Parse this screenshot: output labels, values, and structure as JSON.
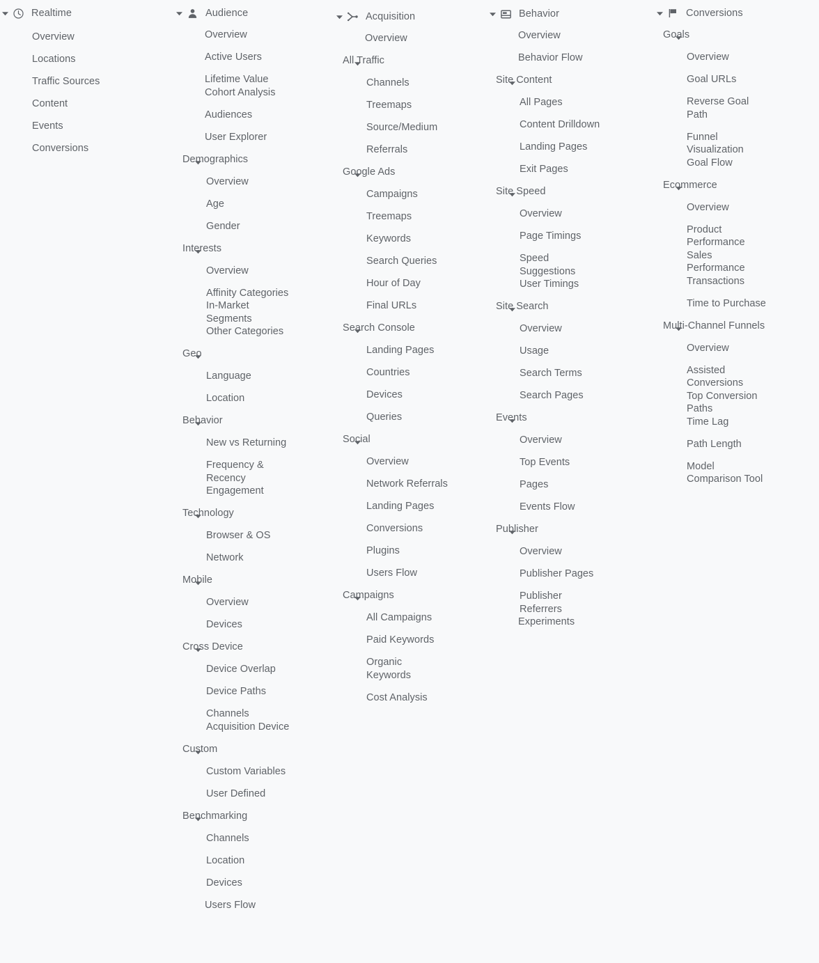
{
  "page": {
    "title": "Analytics Report Navigation Sitemap",
    "background_color": "#f8f9fa",
    "text_color": "#5f6368"
  },
  "columns": [
    {
      "id": "realtime",
      "icon": "clock-icon",
      "header": "Realtime",
      "items": [
        {
          "label": "Overview",
          "depth": 1,
          "group": false,
          "gap": "normal"
        },
        {
          "label": "Locations",
          "depth": 1,
          "group": false,
          "gap": "normal"
        },
        {
          "label": "Traffic Sources",
          "depth": 1,
          "group": false,
          "gap": "normal"
        },
        {
          "label": "Content",
          "depth": 1,
          "group": false,
          "gap": "normal"
        },
        {
          "label": "Events",
          "depth": 1,
          "group": false,
          "gap": "normal"
        },
        {
          "label": "Conversions",
          "depth": 1,
          "group": false,
          "gap": "normal"
        }
      ]
    },
    {
      "id": "audience",
      "icon": "person-icon",
      "header": "Audience",
      "items": [
        {
          "label": "Overview",
          "depth": 0,
          "group": false,
          "gap": "first"
        },
        {
          "label": "Active Users",
          "depth": 0,
          "group": false,
          "gap": "normal"
        },
        {
          "label": "Lifetime Value",
          "depth": 0,
          "group": false,
          "gap": "normal"
        },
        {
          "label": "Cohort Analysis",
          "depth": 0,
          "group": false,
          "gap": "tight"
        },
        {
          "label": "Audiences",
          "depth": 0,
          "group": false,
          "gap": "normal"
        },
        {
          "label": "User Explorer",
          "depth": 0,
          "group": false,
          "gap": "normal"
        },
        {
          "label": "Demographics",
          "depth": 0,
          "group": true,
          "gap": "normal"
        },
        {
          "label": "Overview",
          "depth": 1,
          "group": false,
          "gap": "normal"
        },
        {
          "label": "Age",
          "depth": 1,
          "group": false,
          "gap": "normal"
        },
        {
          "label": "Gender",
          "depth": 1,
          "group": false,
          "gap": "normal"
        },
        {
          "label": "Interests",
          "depth": 0,
          "group": true,
          "gap": "normal"
        },
        {
          "label": "Overview",
          "depth": 1,
          "group": false,
          "gap": "normal"
        },
        {
          "label": "Affinity Categories",
          "depth": 1,
          "group": false,
          "gap": "normal"
        },
        {
          "label": "In-Market Segments",
          "depth": 1,
          "group": false,
          "gap": "tight"
        },
        {
          "label": "Other Categories",
          "depth": 1,
          "group": false,
          "gap": "tight"
        },
        {
          "label": "Geo",
          "depth": 0,
          "group": true,
          "gap": "normal"
        },
        {
          "label": "Language",
          "depth": 1,
          "group": false,
          "gap": "normal"
        },
        {
          "label": "Location",
          "depth": 1,
          "group": false,
          "gap": "normal"
        },
        {
          "label": "Behavior",
          "depth": 0,
          "group": true,
          "gap": "normal"
        },
        {
          "label": "New vs Returning",
          "depth": 1,
          "group": false,
          "gap": "normal"
        },
        {
          "label": "Frequency & Recency",
          "depth": 1,
          "group": false,
          "gap": "normal"
        },
        {
          "label": "Engagement",
          "depth": 1,
          "group": false,
          "gap": "tight"
        },
        {
          "label": "Technology",
          "depth": 0,
          "group": true,
          "gap": "normal"
        },
        {
          "label": "Browser & OS",
          "depth": 1,
          "group": false,
          "gap": "normal"
        },
        {
          "label": "Network",
          "depth": 1,
          "group": false,
          "gap": "normal"
        },
        {
          "label": "Mobile",
          "depth": 0,
          "group": true,
          "gap": "normal"
        },
        {
          "label": "Overview",
          "depth": 1,
          "group": false,
          "gap": "normal"
        },
        {
          "label": "Devices",
          "depth": 1,
          "group": false,
          "gap": "normal"
        },
        {
          "label": "Cross Device",
          "depth": 0,
          "group": true,
          "gap": "normal"
        },
        {
          "label": "Device Overlap",
          "depth": 1,
          "group": false,
          "gap": "normal"
        },
        {
          "label": "Device Paths",
          "depth": 1,
          "group": false,
          "gap": "normal"
        },
        {
          "label": "Channels",
          "depth": 1,
          "group": false,
          "gap": "normal"
        },
        {
          "label": "Acquisition Device",
          "depth": 1,
          "group": false,
          "gap": "tight"
        },
        {
          "label": "Custom",
          "depth": 0,
          "group": true,
          "gap": "normal"
        },
        {
          "label": "Custom Variables",
          "depth": 1,
          "group": false,
          "gap": "normal"
        },
        {
          "label": "User Defined",
          "depth": 1,
          "group": false,
          "gap": "normal"
        },
        {
          "label": "Benchmarking",
          "depth": 0,
          "group": true,
          "gap": "normal"
        },
        {
          "label": "Channels",
          "depth": 1,
          "group": false,
          "gap": "normal"
        },
        {
          "label": "Location",
          "depth": 1,
          "group": false,
          "gap": "normal"
        },
        {
          "label": "Devices",
          "depth": 1,
          "group": false,
          "gap": "normal"
        },
        {
          "label": "Users Flow",
          "depth": 0,
          "group": false,
          "gap": "normal"
        }
      ]
    },
    {
      "id": "acquisition",
      "icon": "branch-icon",
      "header": "Acquisition",
      "items": [
        {
          "label": "Overview",
          "depth": 0,
          "group": false,
          "gap": "first"
        },
        {
          "label": "All Traffic",
          "depth": 0,
          "group": true,
          "gap": "normal"
        },
        {
          "label": "Channels",
          "depth": 1,
          "group": false,
          "gap": "normal"
        },
        {
          "label": "Treemaps",
          "depth": 1,
          "group": false,
          "gap": "normal"
        },
        {
          "label": "Source/Medium",
          "depth": 1,
          "group": false,
          "gap": "normal"
        },
        {
          "label": "Referrals",
          "depth": 1,
          "group": false,
          "gap": "normal"
        },
        {
          "label": "Google Ads",
          "depth": 0,
          "group": true,
          "gap": "normal"
        },
        {
          "label": "Campaigns",
          "depth": 1,
          "group": false,
          "gap": "normal"
        },
        {
          "label": "Treemaps",
          "depth": 1,
          "group": false,
          "gap": "normal"
        },
        {
          "label": "Keywords",
          "depth": 1,
          "group": false,
          "gap": "normal"
        },
        {
          "label": "Search Queries",
          "depth": 1,
          "group": false,
          "gap": "normal"
        },
        {
          "label": "Hour of Day",
          "depth": 1,
          "group": false,
          "gap": "normal"
        },
        {
          "label": "Final URLs",
          "depth": 1,
          "group": false,
          "gap": "normal"
        },
        {
          "label": "Search Console",
          "depth": 0,
          "group": true,
          "gap": "normal"
        },
        {
          "label": "Landing Pages",
          "depth": 1,
          "group": false,
          "gap": "normal"
        },
        {
          "label": "Countries",
          "depth": 1,
          "group": false,
          "gap": "normal"
        },
        {
          "label": "Devices",
          "depth": 1,
          "group": false,
          "gap": "normal"
        },
        {
          "label": "Queries",
          "depth": 1,
          "group": false,
          "gap": "normal"
        },
        {
          "label": "Social",
          "depth": 0,
          "group": true,
          "gap": "normal"
        },
        {
          "label": "Overview",
          "depth": 1,
          "group": false,
          "gap": "normal"
        },
        {
          "label": "Network Referrals",
          "depth": 1,
          "group": false,
          "gap": "normal"
        },
        {
          "label": "Landing Pages",
          "depth": 1,
          "group": false,
          "gap": "normal"
        },
        {
          "label": "Conversions",
          "depth": 1,
          "group": false,
          "gap": "normal"
        },
        {
          "label": "Plugins",
          "depth": 1,
          "group": false,
          "gap": "normal"
        },
        {
          "label": "Users Flow",
          "depth": 1,
          "group": false,
          "gap": "normal"
        },
        {
          "label": "Campaigns",
          "depth": 0,
          "group": true,
          "gap": "normal"
        },
        {
          "label": "All Campaigns",
          "depth": 1,
          "group": false,
          "gap": "normal"
        },
        {
          "label": "Paid Keywords",
          "depth": 1,
          "group": false,
          "gap": "normal"
        },
        {
          "label": "Organic Keywords",
          "depth": 1,
          "group": false,
          "gap": "normal"
        },
        {
          "label": "Cost Analysis",
          "depth": 1,
          "group": false,
          "gap": "normal"
        }
      ]
    },
    {
      "id": "behavior",
      "icon": "layout-icon",
      "header": "Behavior",
      "items": [
        {
          "label": "Overview",
          "depth": 0,
          "group": false,
          "gap": "first"
        },
        {
          "label": "Behavior Flow",
          "depth": 0,
          "group": false,
          "gap": "normal"
        },
        {
          "label": "Site Content",
          "depth": 0,
          "group": true,
          "gap": "normal"
        },
        {
          "label": "All Pages",
          "depth": 1,
          "group": false,
          "gap": "normal"
        },
        {
          "label": "Content Drilldown",
          "depth": 1,
          "group": false,
          "gap": "normal"
        },
        {
          "label": "Landing Pages",
          "depth": 1,
          "group": false,
          "gap": "normal"
        },
        {
          "label": "Exit Pages",
          "depth": 1,
          "group": false,
          "gap": "normal"
        },
        {
          "label": "Site Speed",
          "depth": 0,
          "group": true,
          "gap": "normal"
        },
        {
          "label": "Overview",
          "depth": 1,
          "group": false,
          "gap": "normal"
        },
        {
          "label": "Page Timings",
          "depth": 1,
          "group": false,
          "gap": "normal"
        },
        {
          "label": "Speed Suggestions",
          "depth": 1,
          "group": false,
          "gap": "normal"
        },
        {
          "label": "User Timings",
          "depth": 1,
          "group": false,
          "gap": "tight"
        },
        {
          "label": "Site Search",
          "depth": 0,
          "group": true,
          "gap": "normal"
        },
        {
          "label": "Overview",
          "depth": 1,
          "group": false,
          "gap": "normal"
        },
        {
          "label": "Usage",
          "depth": 1,
          "group": false,
          "gap": "normal"
        },
        {
          "label": "Search Terms",
          "depth": 1,
          "group": false,
          "gap": "normal"
        },
        {
          "label": "Search Pages",
          "depth": 1,
          "group": false,
          "gap": "normal"
        },
        {
          "label": "Events",
          "depth": 0,
          "group": true,
          "gap": "normal"
        },
        {
          "label": "Overview",
          "depth": 1,
          "group": false,
          "gap": "normal"
        },
        {
          "label": "Top Events",
          "depth": 1,
          "group": false,
          "gap": "normal"
        },
        {
          "label": "Pages",
          "depth": 1,
          "group": false,
          "gap": "normal"
        },
        {
          "label": "Events Flow",
          "depth": 1,
          "group": false,
          "gap": "normal"
        },
        {
          "label": "Publisher",
          "depth": 0,
          "group": true,
          "gap": "normal"
        },
        {
          "label": "Overview",
          "depth": 1,
          "group": false,
          "gap": "normal"
        },
        {
          "label": "Publisher Pages",
          "depth": 1,
          "group": false,
          "gap": "normal"
        },
        {
          "label": "Publisher Referrers",
          "depth": 1,
          "group": false,
          "gap": "normal"
        },
        {
          "label": "Experiments",
          "depth": 0,
          "group": false,
          "gap": "tight"
        }
      ]
    },
    {
      "id": "conversions",
      "icon": "flag-icon",
      "header": "Conversions",
      "items": [
        {
          "label": "Goals",
          "depth": 0,
          "group": true,
          "gap": "first"
        },
        {
          "label": "Overview",
          "depth": 1,
          "group": false,
          "gap": "normal"
        },
        {
          "label": "Goal URLs",
          "depth": 1,
          "group": false,
          "gap": "normal"
        },
        {
          "label": "Reverse Goal Path",
          "depth": 1,
          "group": false,
          "gap": "normal"
        },
        {
          "label": "Funnel Visualization",
          "depth": 1,
          "group": false,
          "gap": "normal"
        },
        {
          "label": "Goal Flow",
          "depth": 1,
          "group": false,
          "gap": "tight"
        },
        {
          "label": "Ecommerce",
          "depth": 0,
          "group": true,
          "gap": "normal"
        },
        {
          "label": "Overview",
          "depth": 1,
          "group": false,
          "gap": "normal"
        },
        {
          "label": "Product Performance",
          "depth": 1,
          "group": false,
          "gap": "normal"
        },
        {
          "label": "Sales Performance",
          "depth": 1,
          "group": false,
          "gap": "tight"
        },
        {
          "label": "Transactions",
          "depth": 1,
          "group": false,
          "gap": "tight"
        },
        {
          "label": "Time to Purchase",
          "depth": 1,
          "group": false,
          "gap": "normal"
        },
        {
          "label": "Multi-Channel Funnels",
          "depth": 0,
          "group": true,
          "gap": "normal"
        },
        {
          "label": "Overview",
          "depth": 1,
          "group": false,
          "gap": "normal"
        },
        {
          "label": "Assisted Conversions",
          "depth": 1,
          "group": false,
          "gap": "normal"
        },
        {
          "label": "Top Conversion Paths",
          "depth": 1,
          "group": false,
          "gap": "tight"
        },
        {
          "label": "Time Lag",
          "depth": 1,
          "group": false,
          "gap": "tight"
        },
        {
          "label": "Path Length",
          "depth": 1,
          "group": false,
          "gap": "normal"
        },
        {
          "label": "Model Comparison Tool",
          "depth": 1,
          "group": false,
          "gap": "normal"
        }
      ]
    }
  ]
}
